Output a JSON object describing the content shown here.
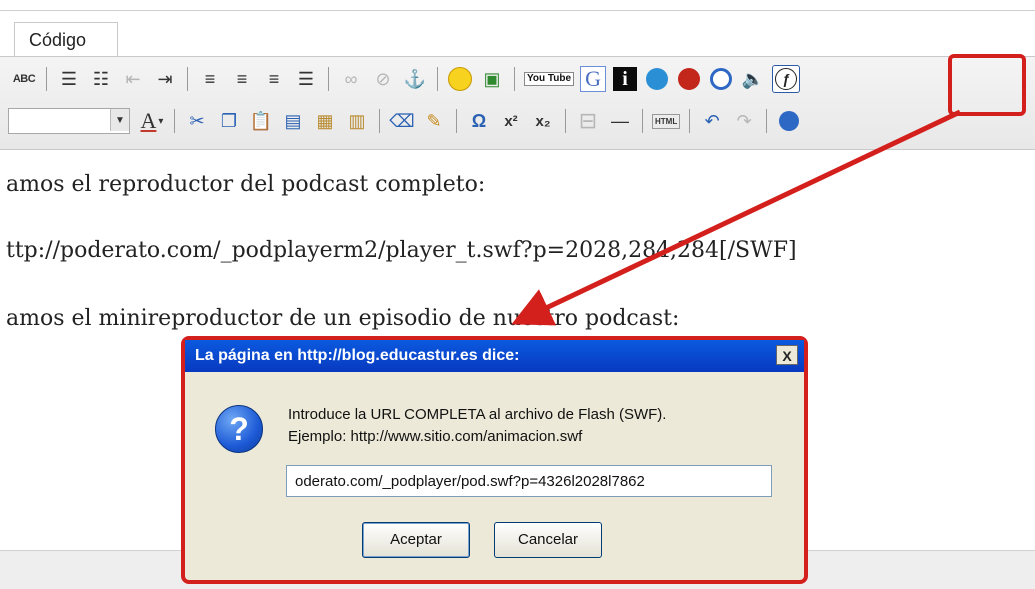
{
  "editor": {
    "tab_label": "Código",
    "content_lines": [
      "amos el reproductor del podcast completo:",
      "ttp://poderato.com/_podplayerm2/player_t.swf?p=2028,284,284[/SWF]",
      "amos el minireproductor de un episodio de nuestro podcast:"
    ]
  },
  "toolbar": {
    "spellcheck": "ABC",
    "youtube": "You Tube",
    "g_button": "G",
    "i_button": "i",
    "omega": "Ω",
    "superscript": "x²",
    "subscript": "x₂",
    "html_button": "HTML",
    "font_color": "A"
  },
  "dialog": {
    "title": "La página en http://blog.educastur.es dice:",
    "close_symbol": "X",
    "message_line1": "Introduce la URL COMPLETA al archivo de Flash (SWF).",
    "message_line2": "Ejemplo: http://www.sitio.com/animacion.swf",
    "input_value": "oderato.com/_podplayer/pod.swf?p=4326l2028l7862",
    "ok_label": "Aceptar",
    "cancel_label": "Cancelar",
    "icon_glyph": "?"
  },
  "colors": {
    "highlight": "#d4201c",
    "title_bar": "#0a5adf"
  }
}
